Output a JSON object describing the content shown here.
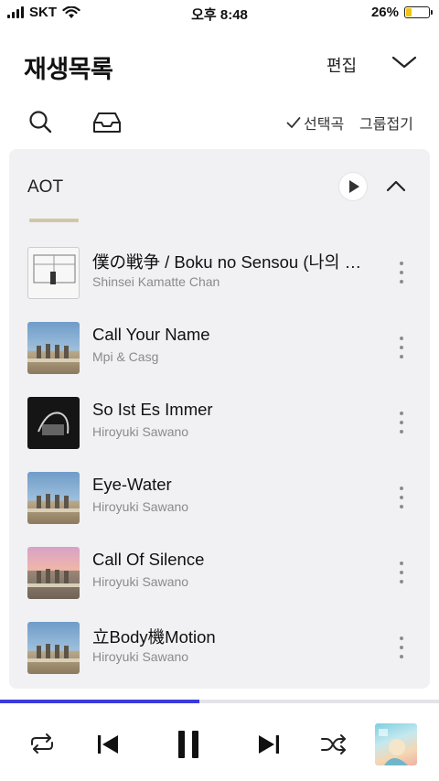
{
  "status_bar": {
    "carrier": "SKT",
    "time": "오후 8:48",
    "battery": "26%",
    "battery_level": 0.26
  },
  "header": {
    "title": "재생목록",
    "edit_label": "편집"
  },
  "toolbar": {
    "select_label": "선택곡",
    "group_label": "그룹접기"
  },
  "playlist": {
    "name": "AOT",
    "tracks": [
      {
        "title": "僕の戦争 / Boku no Sensou (나의 전쟁)",
        "artist": "Shinsei Kamatte Chan",
        "art": "sketch"
      },
      {
        "title": "Call Your Name",
        "artist": "Mpi & Casg",
        "art": "titan"
      },
      {
        "title": "So Ist Es Immer",
        "artist": "Hiroyuki Sawano",
        "art": "dark"
      },
      {
        "title": "Eye-Water",
        "artist": "Hiroyuki Sawano",
        "art": "titan"
      },
      {
        "title": "Call Of Silence",
        "artist": "Hiroyuki Sawano",
        "art": "pink"
      },
      {
        "title": "立Body機Motion",
        "artist": "Hiroyuki Sawano",
        "art": "titan"
      }
    ]
  },
  "player": {
    "progress": 0.455,
    "accent_color": "#3b3bdb"
  },
  "icons": [
    "wifi-icon",
    "search-icon",
    "inbox-icon",
    "check-icon",
    "chevron-down-icon",
    "chevron-up-icon",
    "play-icon",
    "more-vertical-icon",
    "repeat-icon",
    "previous-icon",
    "pause-icon",
    "next-icon",
    "shuffle-icon"
  ]
}
